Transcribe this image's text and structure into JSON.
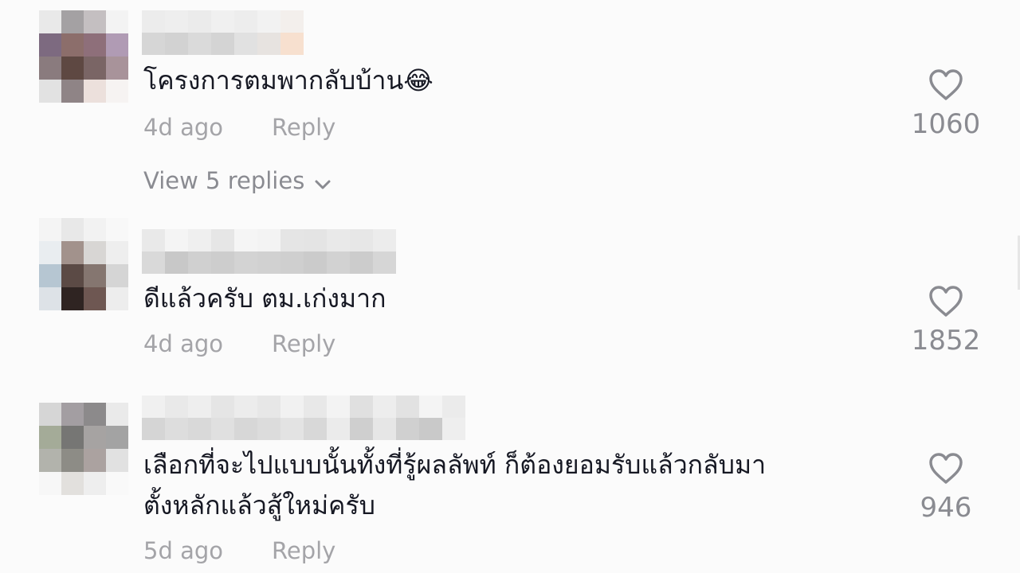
{
  "comments": [
    {
      "text": "โครงการตมพากลับบ้าน😂",
      "time": "4d ago",
      "reply_label": "Reply",
      "likes": "1060",
      "view_replies": "View 5 replies"
    },
    {
      "text": "ดีแล้วครับ ตม.เก่งมาก",
      "time": "4d ago",
      "reply_label": "Reply",
      "likes": "1852"
    },
    {
      "text_line1": "เลือกที่จะไปแบบนั้นทั้งที่รู้ผลลัพท์ ก็ต้องยอมรับแล้วกลับมา",
      "text_line2": "ตั้งหลักแล้วสู้ใหม่ครับ",
      "time": "5d ago",
      "reply_label": "Reply",
      "likes": "946"
    }
  ],
  "icons": {
    "like": "heart-outline-icon",
    "expand": "chevron-down-icon"
  },
  "colors": {
    "background": "#fbfbfb",
    "text_primary": "#161823",
    "text_secondary": "#a4a4a8",
    "icon": "#8a8b91"
  }
}
